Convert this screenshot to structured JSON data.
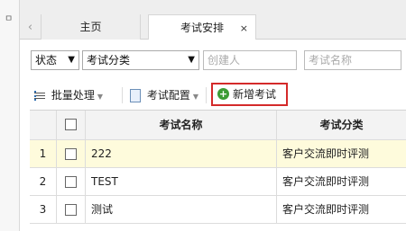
{
  "sidebar": {
    "pin_icon": "pin-icon",
    "pin_glyph": "ㅁ"
  },
  "tabs": {
    "back_glyph": "‹",
    "items": [
      {
        "label": "主页"
      },
      {
        "label": "考试安排",
        "close": "×"
      }
    ]
  },
  "filters": {
    "status": "状态",
    "category": "考试分类",
    "creator_placeholder": "创建人",
    "name_placeholder": "考试名称"
  },
  "toolbar": {
    "batch_label": "批量处理",
    "config_label": "考试配置",
    "add_label": "新增考试",
    "add_icon_glyph": "+"
  },
  "table": {
    "columns": [
      "考试名称",
      "考试分类"
    ],
    "rows": [
      {
        "num": "1",
        "name": "222",
        "category": "客户交流即时评测"
      },
      {
        "num": "2",
        "name": "TEST",
        "category": "客户交流即时评测"
      },
      {
        "num": "3",
        "name": "测试",
        "category": "客户交流即时评测"
      }
    ]
  },
  "colors": {
    "highlight_border": "#d42a2a",
    "selected_row": "#fefbdc",
    "add_icon": "#3d9c35"
  }
}
